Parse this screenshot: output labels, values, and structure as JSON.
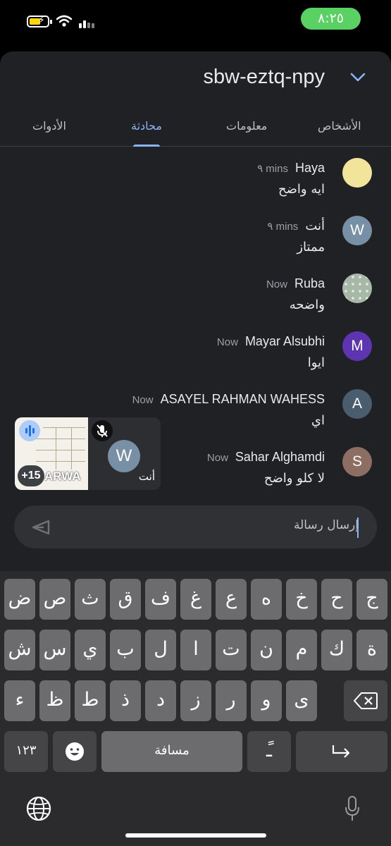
{
  "status_bar": {
    "time": "٨:٢٥"
  },
  "header": {
    "meeting_code": "sbw-eztq-npy"
  },
  "tabs": [
    {
      "label": "الأشخاص"
    },
    {
      "label": "معلومات"
    },
    {
      "label": "محادثة",
      "active": true
    },
    {
      "label": "الأدوات"
    }
  ],
  "messages": [
    {
      "sender": "Haya",
      "time": "٩ mins",
      "text": "ايه واضح",
      "avatar_letter": "",
      "avatar_color": "#f3e49b"
    },
    {
      "sender": "أنت",
      "time": "٩ mins",
      "text": "ممتاز",
      "avatar_letter": "W",
      "avatar_color": "#7890a5"
    },
    {
      "sender": "Ruba",
      "time": "Now",
      "text": "واضحه",
      "avatar_letter": "",
      "avatar_color": "#a8b8a8"
    },
    {
      "sender": "Mayar Alsubhi",
      "time": "Now",
      "text": "ايوا",
      "avatar_letter": "M",
      "avatar_color": "#5e35b1"
    },
    {
      "sender": "ASAYEL RAHMAN WAHESS",
      "time": "Now",
      "text": "اي",
      "avatar_letter": "A",
      "avatar_color": "#4a5d6e"
    },
    {
      "sender": "Sahar Alghamdi",
      "time": "Now",
      "text": "لا كلو واضح",
      "avatar_letter": "S",
      "avatar_color": "#8d6e63"
    }
  ],
  "pip": {
    "presenter_label": "ARWA",
    "others_count": "+15",
    "self_avatar_letter": "W",
    "self_label": "أنت"
  },
  "composer": {
    "placeholder": "إرسال رسالة"
  },
  "keyboard": {
    "row1": [
      "ض",
      "ص",
      "ث",
      "ق",
      "ف",
      "غ",
      "ع",
      "ه",
      "خ",
      "ح",
      "ج"
    ],
    "row2": [
      "ش",
      "س",
      "ي",
      "ب",
      "ل",
      "ا",
      "ت",
      "ن",
      "م",
      "ك",
      "ة"
    ],
    "row3": [
      "ء",
      "ظ",
      "ط",
      "ذ",
      "د",
      "ز",
      "ر",
      "و",
      "ى"
    ],
    "numbers_key": "١٢٣",
    "space_label": "مسافة",
    "diacritic_key": "ًـ"
  }
}
